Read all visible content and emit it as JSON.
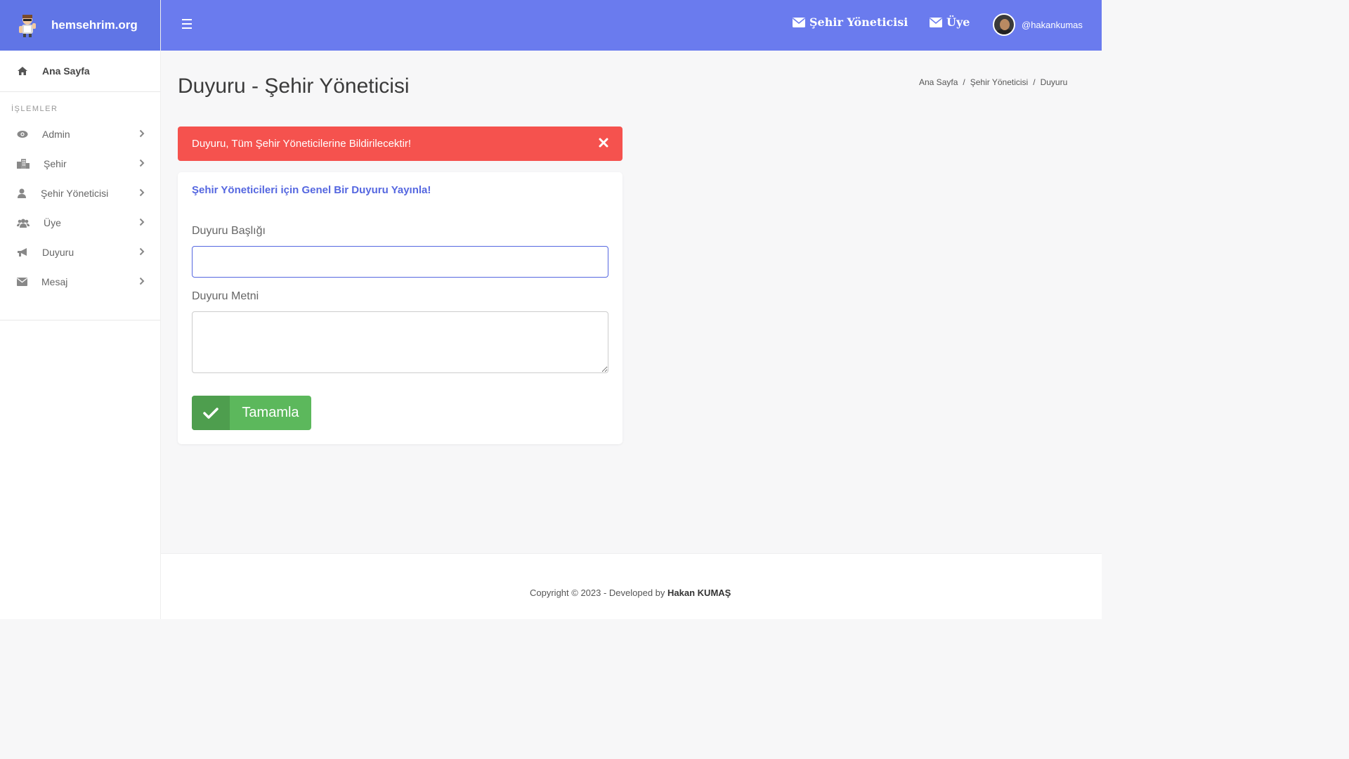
{
  "brand": {
    "name": "hemsehrim.org",
    "logo_icon": "mascot-logo-icon"
  },
  "sidebar": {
    "home_label": "Ana Sayfa",
    "section_title": "İŞLEMLER",
    "items": [
      {
        "label": "Admin",
        "icon": "eye-icon"
      },
      {
        "label": "Şehir",
        "icon": "city-icon"
      },
      {
        "label": "Şehir Yöneticisi",
        "icon": "user-icon"
      },
      {
        "label": "Üye",
        "icon": "users-icon"
      },
      {
        "label": "Duyuru",
        "icon": "bullhorn-icon"
      },
      {
        "label": "Mesaj",
        "icon": "envelope-icon"
      }
    ]
  },
  "topbar": {
    "link1": "Şehir Yöneticisi",
    "link2": "Üye",
    "username": "@hakankumas",
    "colors": {
      "background": "#6a7bee",
      "brand_bg": "#6075e6"
    }
  },
  "page": {
    "title": "Duyuru - Şehir Yöneticisi",
    "breadcrumb": [
      "Ana Sayfa",
      "Şehir Yöneticisi",
      "Duyuru"
    ]
  },
  "alert": {
    "text": "Duyuru, Tüm Şehir Yöneticilerine Bildirilecektir!",
    "color": "#f5524e"
  },
  "form": {
    "card_title": "Şehir Yöneticileri için Genel Bir Duyuru Yayınla!",
    "title_label": "Duyuru Başlığı",
    "title_value": "",
    "body_label": "Duyuru Metni",
    "body_value": "",
    "submit_label": "Tamamla",
    "submit_color": "#5cb85c"
  },
  "footer": {
    "prefix": "Copyright © 2023 - Developed by ",
    "author": "Hakan KUMAŞ"
  }
}
